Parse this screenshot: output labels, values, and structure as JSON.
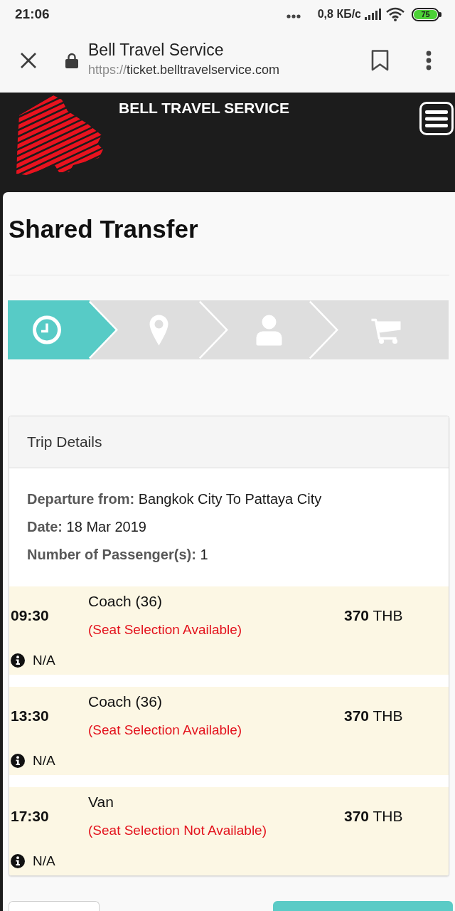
{
  "status_bar": {
    "time": "21:06",
    "network_speed": "0,8 КБ/с",
    "battery": "75"
  },
  "browser": {
    "title": "Bell Travel Service",
    "url_scheme": "https://",
    "url_host": "ticket.belltravelservice.com"
  },
  "header": {
    "brand": "BELL TRAVEL SERVICE"
  },
  "page": {
    "title": "Shared Transfer"
  },
  "steps": [
    {
      "selected": true
    },
    {
      "selected": false
    },
    {
      "selected": false
    },
    {
      "selected": false
    }
  ],
  "trip_details": {
    "title": "Trip Details",
    "fields": [
      {
        "label": "Departure from:",
        "value": "Bangkok City To Pattaya City"
      },
      {
        "label": "Date:",
        "value": "18 Mar 2019"
      },
      {
        "label": "Number of Passenger(s):",
        "value": "1"
      }
    ],
    "trips": [
      {
        "time": "09:30",
        "vehicle": "Coach (36)",
        "seat_note": "(Seat Selection Available)",
        "price": "370",
        "currency": "THB",
        "info": "N/A"
      },
      {
        "time": "13:30",
        "vehicle": "Coach (36)",
        "seat_note": "(Seat Selection Available)",
        "price": "370",
        "currency": "THB",
        "info": "N/A"
      },
      {
        "time": "17:30",
        "vehicle": "Van",
        "seat_note": "(Seat Selection Not Available)",
        "price": "370",
        "currency": "THB",
        "info": "N/A"
      }
    ]
  },
  "actions": [
    {
      "kind": "secondary"
    },
    {
      "kind": "primary"
    }
  ]
}
